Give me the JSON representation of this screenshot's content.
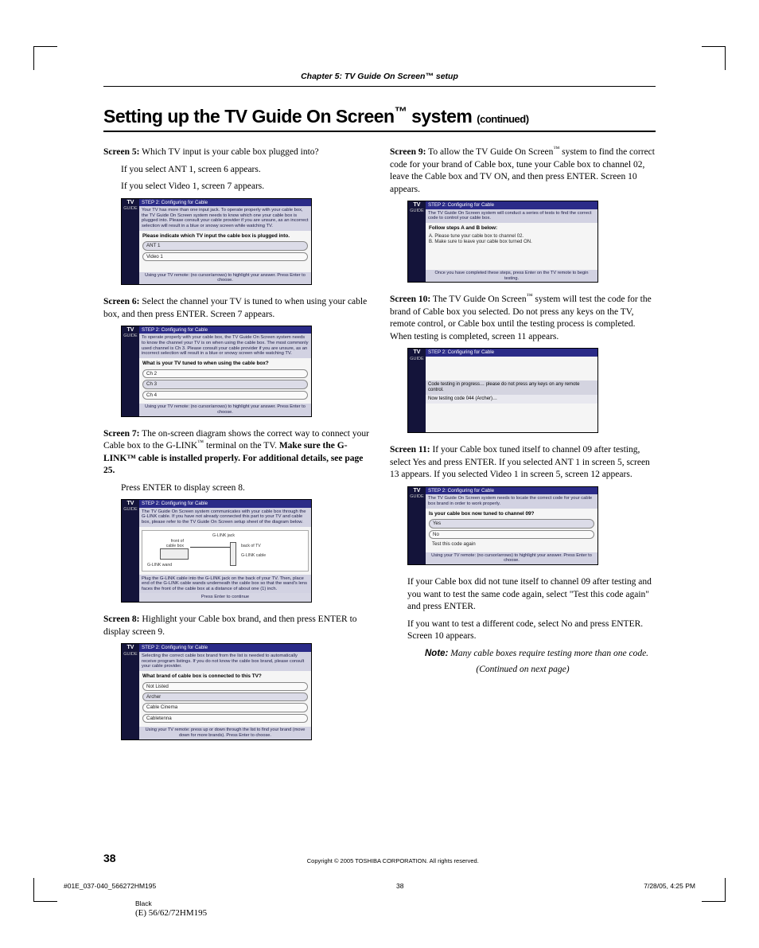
{
  "header": {
    "chapter": "Chapter 5: TV Guide On Screen™ setup",
    "title_main": "Setting up the TV Guide On Screen",
    "title_tm": "™",
    "title_sys": " system ",
    "title_cont": "(continued)"
  },
  "left": {
    "s5": {
      "label": "Screen 5:",
      "text": " Which TV input is your cable box plugged into?",
      "line2": "If you select ANT 1, screen 6 appears.",
      "line3": "If you select Video 1, screen 7 appears."
    },
    "s6": {
      "label": "Screen 6:",
      "text": " Select the channel your TV is tuned to when using your cable box, and then press ENTER. Screen 7 appears."
    },
    "s7": {
      "label": "Screen 7:",
      "text_a": " The on-screen diagram shows the correct way to connect your Cable box to the G-LINK",
      "text_b": " terminal on the TV. ",
      "bold": "Make sure the G-LINK™ cable is installed properly. For additional details, see page 25.",
      "line2": "Press ENTER to display screen 8."
    },
    "s8": {
      "label": "Screen 8:",
      "text": " Highlight your Cable box brand, and then press ENTER to display screen 9."
    }
  },
  "right": {
    "s9": {
      "label": "Screen 9:",
      "text_a": " To allow the TV Guide On Screen",
      "text_b": " system to find the correct code for your brand of Cable box, tune your Cable box to channel 02, leave the Cable box and TV ON, and then press ENTER. Screen 10 appears."
    },
    "s10": {
      "label": "Screen 10:",
      "text_a": " The TV Guide On Screen",
      "text_b": " system will test the code for the brand of Cable box you selected. Do not press any keys on the TV, remote control, or Cable box until the testing process is completed. When testing is completed, screen 11 appears."
    },
    "s11": {
      "label": "Screen 11:",
      "text": " If your Cable box tuned itself to channel 09 after testing, select Yes and press ENTER. If you selected ANT 1 in screen 5, screen 13 appears. If you selected Video 1 in screen 5, screen 12 appears."
    },
    "after1": "If your Cable box did not tune itself to channel 09 after testing and you want to test the same code again, select \"Test this code again\" and press ENTER.",
    "after2": "If you want to test a different code, select No and press ENTER. Screen 10 appears.",
    "note_label": "Note:",
    "note_body": " Many cable boxes require testing more than one code.",
    "continued": "(Continued on next page)"
  },
  "shots": {
    "hdr": "STEP 2: Configuring for Cable",
    "tv": "TV",
    "guide": "GUIDE",
    "ftr_remote": "Using your TV remote: (no cursor/arrows) to highlight your answer. Press Enter to choose.",
    "s5": {
      "blurb": "Your TV has more than one input jack. To operate properly with your cable box, the TV Guide On Screen system needs to know which one your cable box is plugged into. Please consult your cable provider if you are unsure, as an incorrect selection will result in a blue or snowy screen while watching TV.",
      "q": "Please indicate which TV input the cable box is plugged into.",
      "opts": [
        "ANT 1",
        "Video 1"
      ]
    },
    "s6": {
      "blurb": "To operate properly with your cable box, the TV Guide On Screen system needs to know the channel your TV is on when using the cable box. The most commonly used channel is Ch 3. Please consult your cable provider if you are unsure, as an incorrect selection will result in a blue or snowy screen while watching TV.",
      "q": "What is your TV tuned to when using the cable box?",
      "opts": [
        "Ch 2",
        "Ch 3",
        "Ch 4"
      ]
    },
    "s7": {
      "blurb": "The TV Guide On Screen system communicates with your cable box through the G-LINK cable. If you have not already connected this part to your TV and cable box, please refer to the TV Guide On Screen setup sheet of the diagram below.",
      "diag": {
        "front": "front of cable box",
        "back": "back of TV",
        "glinkjack": "G-LINK jack",
        "glinkcable": "G-LINK cable",
        "wand": "G-LINK wand"
      },
      "blurb2": "Plug the G-LINK cable into the G-LINK jack on the back of your TV. Then, place end of the G-LINK cable wands underneath the cable box so that the wand's lens faces the front of the cable box at a distance of about one (1) inch.",
      "ftr": "Press Enter to continue"
    },
    "s8": {
      "blurb": "Selecting the correct cable box brand from the list is needed to automatically receive program listings. If you do not know the cable box brand, please consult your cable provider.",
      "q": "What brand of cable box is connected to this TV?",
      "opts": [
        "Not Listed",
        "Archer",
        "Cable Cinema",
        "Cabletenna"
      ],
      "ftr": "Using your TV remote: press up or down through the list to find your brand (move down for more brands). Press Enter to choose."
    },
    "s9": {
      "blurb": "The TV Guide On Screen system will conduct a series of tests to find the correct code to control your cable box.",
      "q": "Follow steps A and B below:",
      "a": "A.  Please tune your cable box to channel 02.",
      "b": "B.  Make sure to leave your cable box turned ON.",
      "ftr": "Once you have completed these steps, press Enter on the TV remote to begin testing."
    },
    "s10": {
      "p1": "Code testing in progress… please do not press any keys on any remote control.",
      "p2": "Now testing code 044 (Archer)…"
    },
    "s11": {
      "blurb": "The TV Guide On Screen system needs to locate the correct code for your cable box brand in order to work properly.",
      "q": "Is your cable box now tuned to channel 09?",
      "opts": [
        "Yes",
        "No",
        "Test this code again"
      ]
    }
  },
  "footer": {
    "page": "38",
    "copyright": "Copyright © 2005 TOSHIBA CORPORATION. All rights reserved.",
    "file": "#01E_037-040_566272HM195",
    "mid": "38",
    "date": "7/28/05, 4:25 PM",
    "black": "Black",
    "model": "(E) 56/62/72HM195"
  }
}
